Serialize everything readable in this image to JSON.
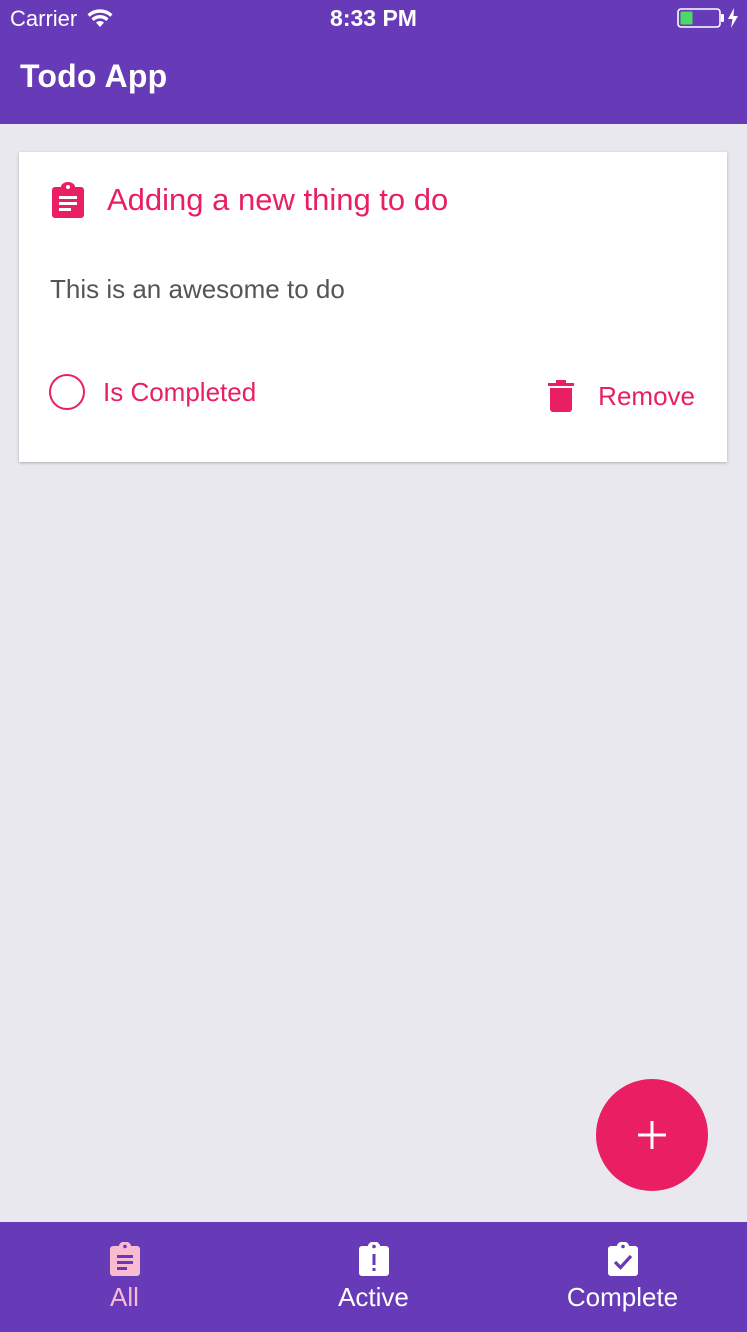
{
  "status_bar": {
    "carrier": "Carrier",
    "time": "8:33 PM"
  },
  "app_bar": {
    "title": "Todo App"
  },
  "todos": [
    {
      "title": "Adding a new thing to do",
      "description": "This is an awesome to do",
      "completed_label": "Is Completed",
      "remove_label": "Remove",
      "icon": "clipboard-text-icon"
    }
  ],
  "fab": {
    "icon": "plus-icon"
  },
  "bottom_nav": {
    "items": [
      {
        "label": "All",
        "icon": "clipboard-text-icon",
        "selected": true
      },
      {
        "label": "Active",
        "icon": "clipboard-alert-icon",
        "selected": false
      },
      {
        "label": "Complete",
        "icon": "clipboard-check-icon",
        "selected": false
      }
    ]
  },
  "colors": {
    "primary": "#673ab7",
    "accent": "#e91e63",
    "background": "#e9e8ee",
    "nav_selected": "#f8bbd0",
    "battery_level": "#4cd964"
  }
}
